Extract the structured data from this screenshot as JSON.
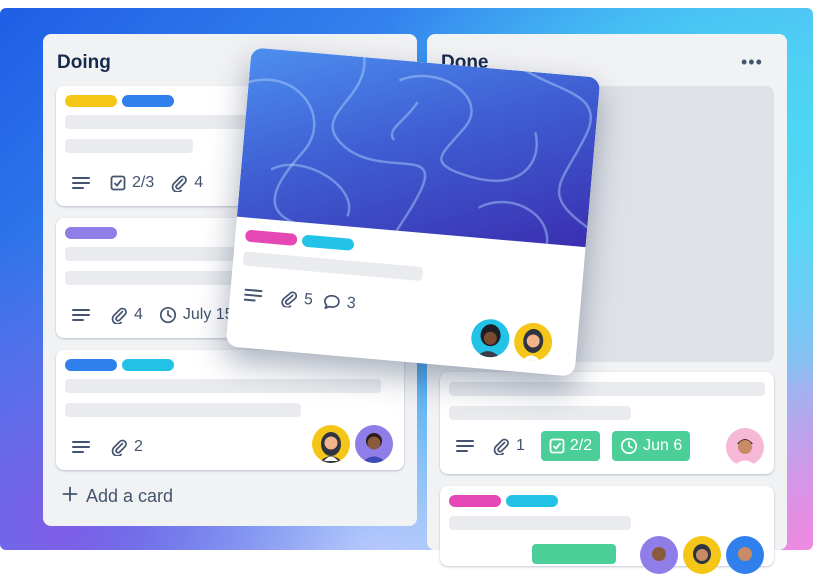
{
  "colors": {
    "yellow": "#f5c518",
    "blue": "#2f80ed",
    "purple": "#8f7ee7",
    "cyan": "#22c3e6",
    "pink": "#e547b5",
    "green": "#4bce97",
    "list_bg": "#f1f2f4"
  },
  "doing": {
    "title": "Doing",
    "menu": "•••",
    "add_card": "Add a card",
    "cards": [
      {
        "checklist": "2/3",
        "attachments": "4"
      },
      {
        "attachments": "4",
        "due": "July 15"
      },
      {
        "attachments": "2"
      }
    ]
  },
  "done": {
    "title": "Done",
    "menu": "•••",
    "cards": [
      {
        "attachments": "1",
        "checklist": "2/2",
        "due": "Jun 6"
      }
    ]
  },
  "dragged_card": {
    "attachments": "5",
    "comments": "3"
  }
}
